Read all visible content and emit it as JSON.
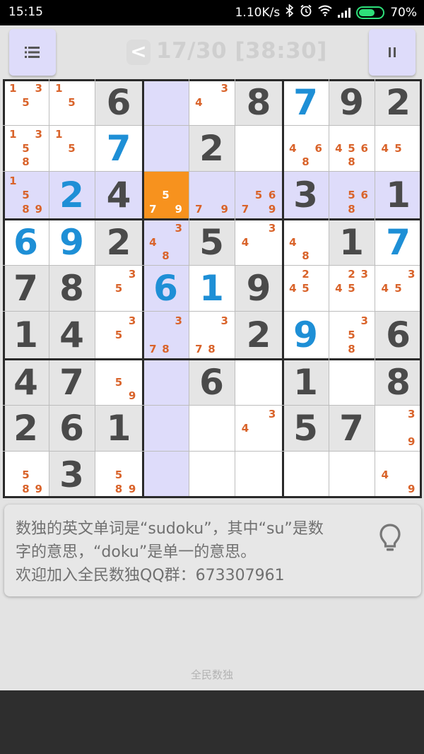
{
  "status_bar": {
    "time": "15:15",
    "network_speed": "1.10K/s",
    "battery_percent": "70%",
    "battery_level": 0.7,
    "icons": [
      "bluetooth-icon",
      "alarm-icon",
      "wifi-icon",
      "signal-icon",
      "battery-icon"
    ]
  },
  "toolbar": {
    "back_label": "<",
    "title": "17/30 [38:30]",
    "menu_icon": "list-icon",
    "pause_icon": "pause-icon"
  },
  "colors": {
    "given": "#4a4a4a",
    "entered": "#1e8fd6",
    "note": "#d9632a",
    "highlight": "#dedcfa",
    "selected": "#f7921e",
    "given_bg": "#e5e5e5",
    "empty_bg": "#ffffff"
  },
  "board": {
    "selected_cell": [
      2,
      3
    ],
    "grid": [
      [
        "n:135",
        "n:15",
        "G6",
        "",
        "n:34",
        "G8",
        "E7",
        "G9",
        "G2"
      ],
      [
        "n:1358",
        "n:15",
        "E7",
        "",
        "G2",
        "",
        "n:468",
        "n:4568",
        "n:45"
      ],
      [
        "n:1589",
        "E2",
        "G4",
        "n:579",
        "n:79",
        "n:5679",
        "G3",
        "n:568",
        "G1"
      ],
      [
        "E6",
        "E9",
        "G2",
        "n:348",
        "G5",
        "n:34",
        "n:48",
        "G1",
        "E7"
      ],
      [
        "G7",
        "G8",
        "n:35",
        "E6",
        "E1",
        "G9",
        "n:245",
        "n:2345",
        "n:345"
      ],
      [
        "G1",
        "G4",
        "n:35",
        "n:378",
        "n:378",
        "G2",
        "E9",
        "n:358",
        "G6"
      ],
      [
        "G4",
        "G7",
        "n:59",
        "",
        "G6",
        "",
        "G1",
        "",
        "G8"
      ],
      [
        "G2",
        "G6",
        "G1",
        "",
        "",
        "n:34",
        "G5",
        "G7",
        "n:39"
      ],
      [
        "n:589",
        "G3",
        "n:589",
        "",
        "",
        "",
        "",
        "",
        "n:49"
      ]
    ]
  },
  "hint": {
    "line1": "数独的英文单词是“sudoku”，其中“su”是数",
    "line2": "字的意思，“doku”是单一的意思。",
    "line3": "欢迎加入全民数独QQ群：673307961",
    "icon": "lightbulb-icon"
  },
  "footer": {
    "label": "全民数独"
  }
}
